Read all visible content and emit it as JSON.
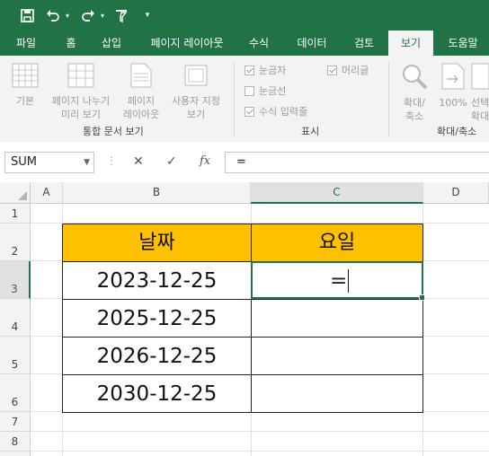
{
  "tabs": [
    "파일",
    "홈",
    "삽입",
    "페이지 레이아웃",
    "수식",
    "데이터",
    "검토",
    "보기",
    "도움말"
  ],
  "active_tab": "보기",
  "ribbon": {
    "views": {
      "normal": "기본",
      "page_break_line1": "페이지 나누기",
      "page_break_line2": "미리 보기",
      "page_layout_line1": "페이지",
      "page_layout_line2": "레이아웃",
      "custom_line1": "사용자 지정",
      "custom_line2": "보기",
      "group_label": "통합 문서 보기"
    },
    "show": {
      "ruler": "눈금자",
      "headings": "머리글",
      "gridlines": "눈금선",
      "formula_bar": "수식 입력줄",
      "group_label": "표시"
    },
    "zoom": {
      "zoom_line1": "확대/",
      "zoom_line2": "축소",
      "hundred": "100%",
      "selection_line1": "선택",
      "selection_line2": "확대",
      "group_label": "확대/축소"
    }
  },
  "formula_bar": {
    "name_box": "SUM",
    "fx": "fx",
    "content": "="
  },
  "columns": [
    "A",
    "B",
    "C",
    "D"
  ],
  "rows": [
    "1",
    "2",
    "3",
    "4",
    "5",
    "6",
    "7",
    "8"
  ],
  "table": {
    "header_date": "날짜",
    "header_day": "요일",
    "dates": [
      "2023-12-25",
      "2025-12-25",
      "2026-12-25",
      "2030-12-25"
    ],
    "editing_value": "="
  },
  "colors": {
    "excel_green": "#217346",
    "header_fill": "#ffc000"
  }
}
